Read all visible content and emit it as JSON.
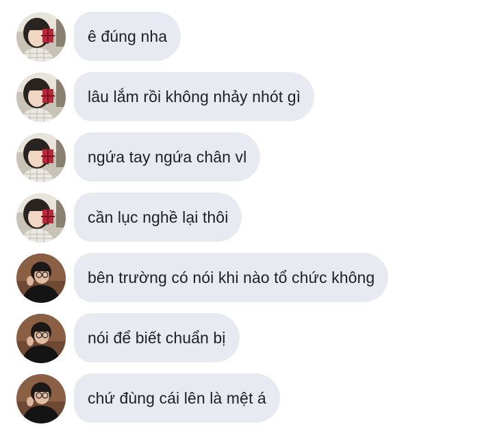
{
  "messages": [
    {
      "sender": "girl",
      "text": "ê đúng nha"
    },
    {
      "sender": "girl",
      "text": "lâu lắm rồi không nhảy nhót gì"
    },
    {
      "sender": "girl",
      "text": "ngứa tay ngứa chân vl"
    },
    {
      "sender": "girl",
      "text": "cần lục nghề lại thôi"
    },
    {
      "sender": "boy",
      "text": "bên trường có nói khi nào tổ chức không"
    },
    {
      "sender": "boy",
      "text": "nói để biết chuẩn bị"
    },
    {
      "sender": "boy",
      "text": "chứ đùng cái lên là mệt á"
    }
  ],
  "colors": {
    "bubble_background": "#e7eaf0",
    "text": "#1b1f26"
  }
}
